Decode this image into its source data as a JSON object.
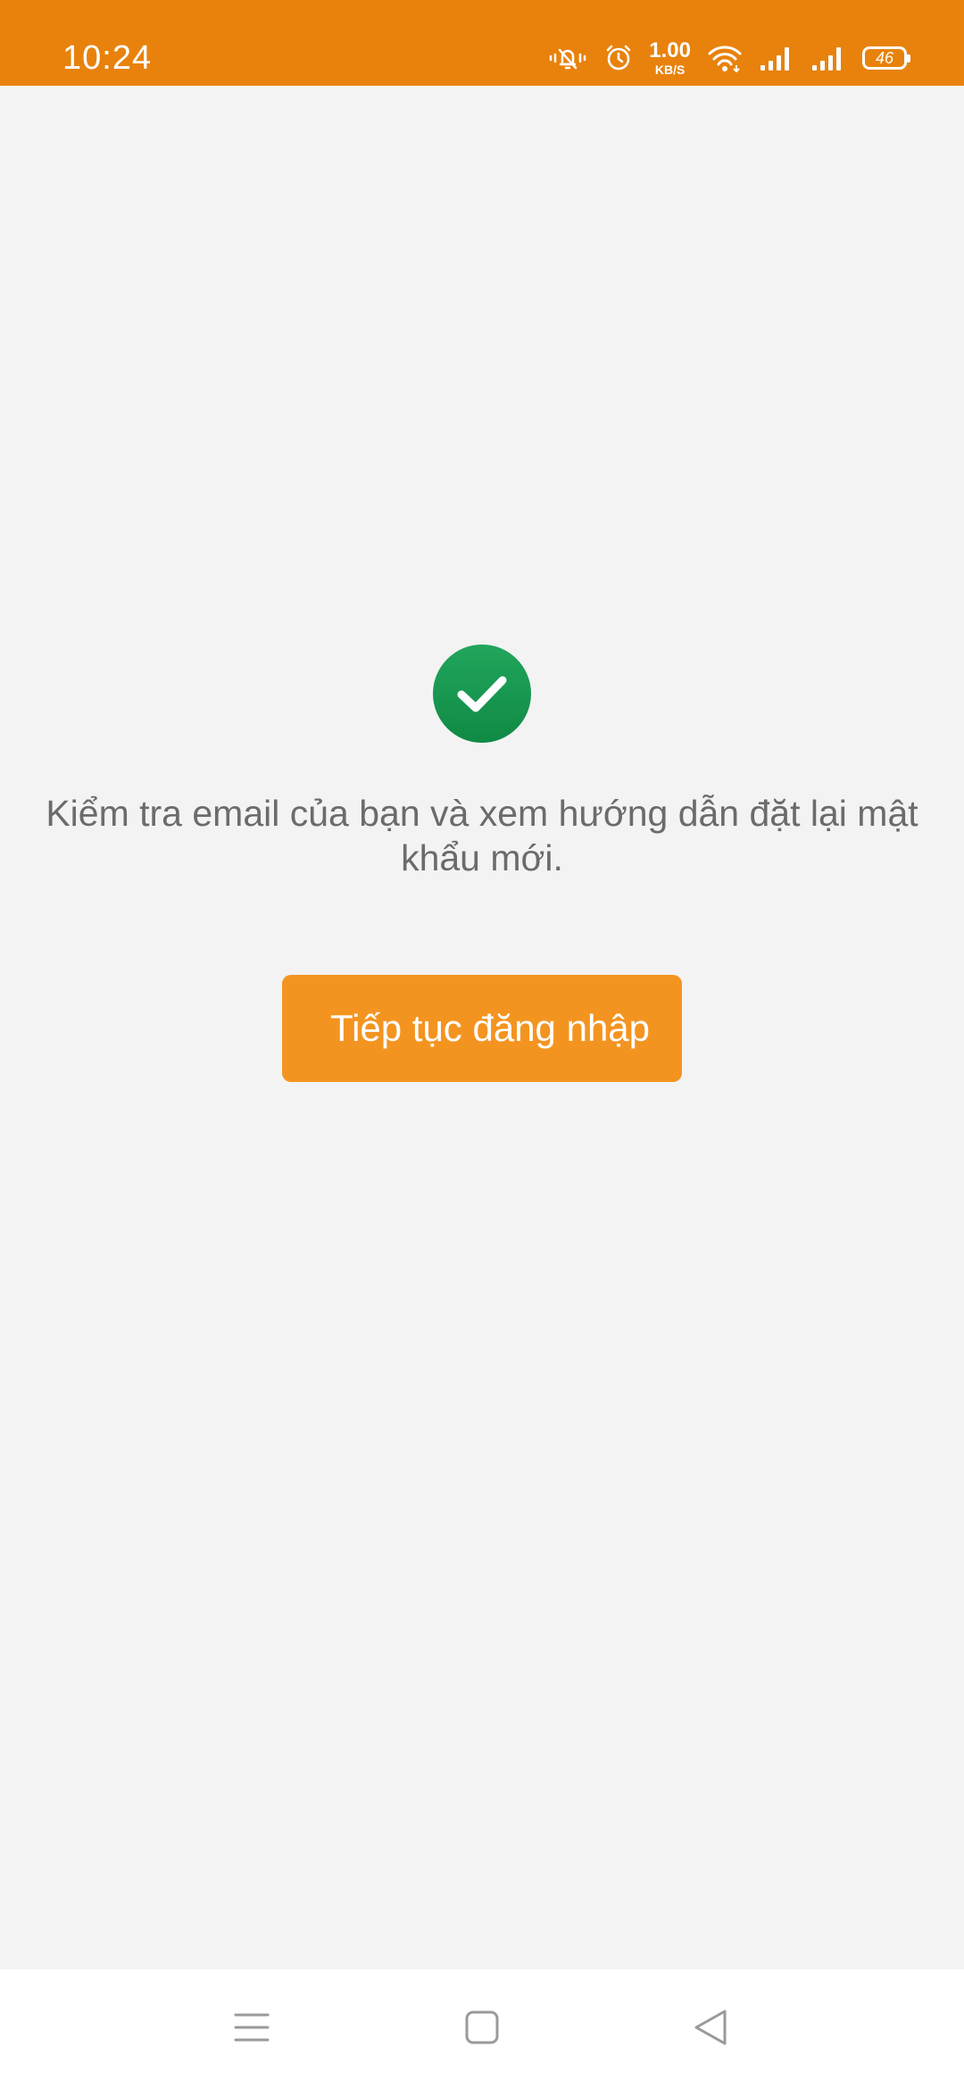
{
  "status_bar": {
    "time": "10:24",
    "net_speed_value": "1.00",
    "net_speed_unit": "KB/S",
    "battery_level": "46",
    "background_color": "#e8820c",
    "icons": [
      "vibrate-mute-icon",
      "alarm-icon",
      "wifi-icon",
      "signal-1-icon",
      "signal-2-icon",
      "battery-icon"
    ]
  },
  "main": {
    "status_icon": "check-circle-icon",
    "status_icon_color": "#1f9d55",
    "message": "Kiểm tra email của bạn và xem hướng dẫn đặt lại mật khẩu mới.",
    "continue_button_label": "Tiếp tục đăng nhập",
    "accent_color": "#f49420"
  },
  "nav_bar": {
    "icons": [
      "menu-icon",
      "home-icon",
      "back-icon"
    ]
  }
}
